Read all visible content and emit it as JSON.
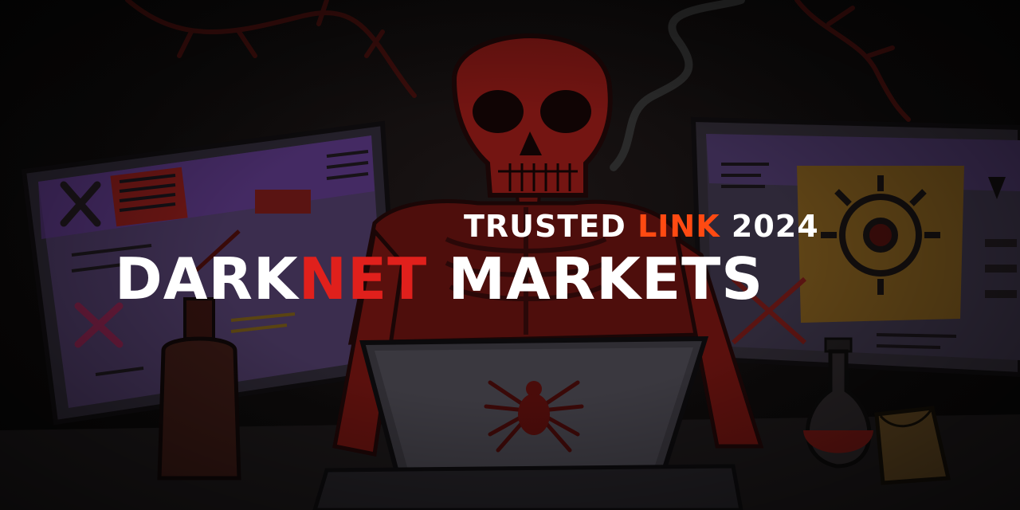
{
  "headline": {
    "line1_a": "TRUSTED ",
    "line1_accent": "LINK",
    "line1_b": " 2024",
    "line2_a": "DARK",
    "line2_accent": "NET",
    "line2_b": " MARKETS"
  },
  "colors": {
    "background": "#0b0909",
    "accent_red": "#e0201c",
    "accent_orange": "#ff4a12",
    "screen_purple": "#3b1f5a",
    "screen_yellow": "#c98a1a",
    "skeleton_red": "#6e1410",
    "headline_text": "#ffffff"
  },
  "icons": {
    "skeleton": "skeleton-icon",
    "laptop": "laptop-icon",
    "spider": "spider-icon",
    "bottle": "bottle-icon",
    "flask": "flask-icon",
    "paper_bag": "paper-bag-icon",
    "left_monitor": "monitor-icon",
    "right_monitor": "monitor-icon",
    "eye": "eye-icon",
    "cross_marks": "cross-icon"
  }
}
